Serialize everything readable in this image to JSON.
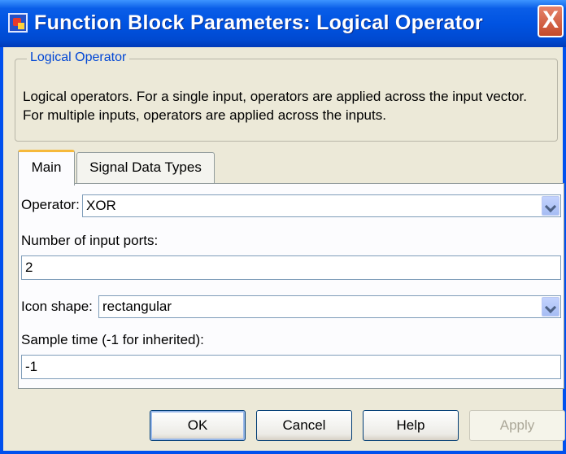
{
  "window": {
    "title": "Function Block Parameters: Logical Operator",
    "close_label": "X"
  },
  "group": {
    "legend": "Logical Operator",
    "desc_line1": "Logical operators.  For a single input, operators are applied across the input vector.",
    "desc_line2": "For multiple inputs, operators are applied across the inputs."
  },
  "tabs": [
    {
      "label": "Main",
      "selected": true
    },
    {
      "label": "Signal Data Types",
      "selected": false
    }
  ],
  "params": {
    "operator": {
      "label": "Operator:",
      "value": "XOR"
    },
    "num_inputs": {
      "label": "Number of input ports:",
      "value": "2"
    },
    "icon_shape": {
      "label": "Icon shape:",
      "value": "rectangular"
    },
    "sample_time": {
      "label": "Sample time (-1 for inherited):",
      "value": "-1"
    }
  },
  "buttons": {
    "ok": "OK",
    "cancel": "Cancel",
    "help": "Help",
    "apply": "Apply"
  },
  "colors": {
    "titlebar": "#0053e1",
    "legend_text": "#0046d5",
    "tab_highlight": "#f6b93b"
  },
  "icons": {
    "app": "simulink-block-icon",
    "close": "close-icon",
    "dropdown": "chevron-down-icon"
  }
}
